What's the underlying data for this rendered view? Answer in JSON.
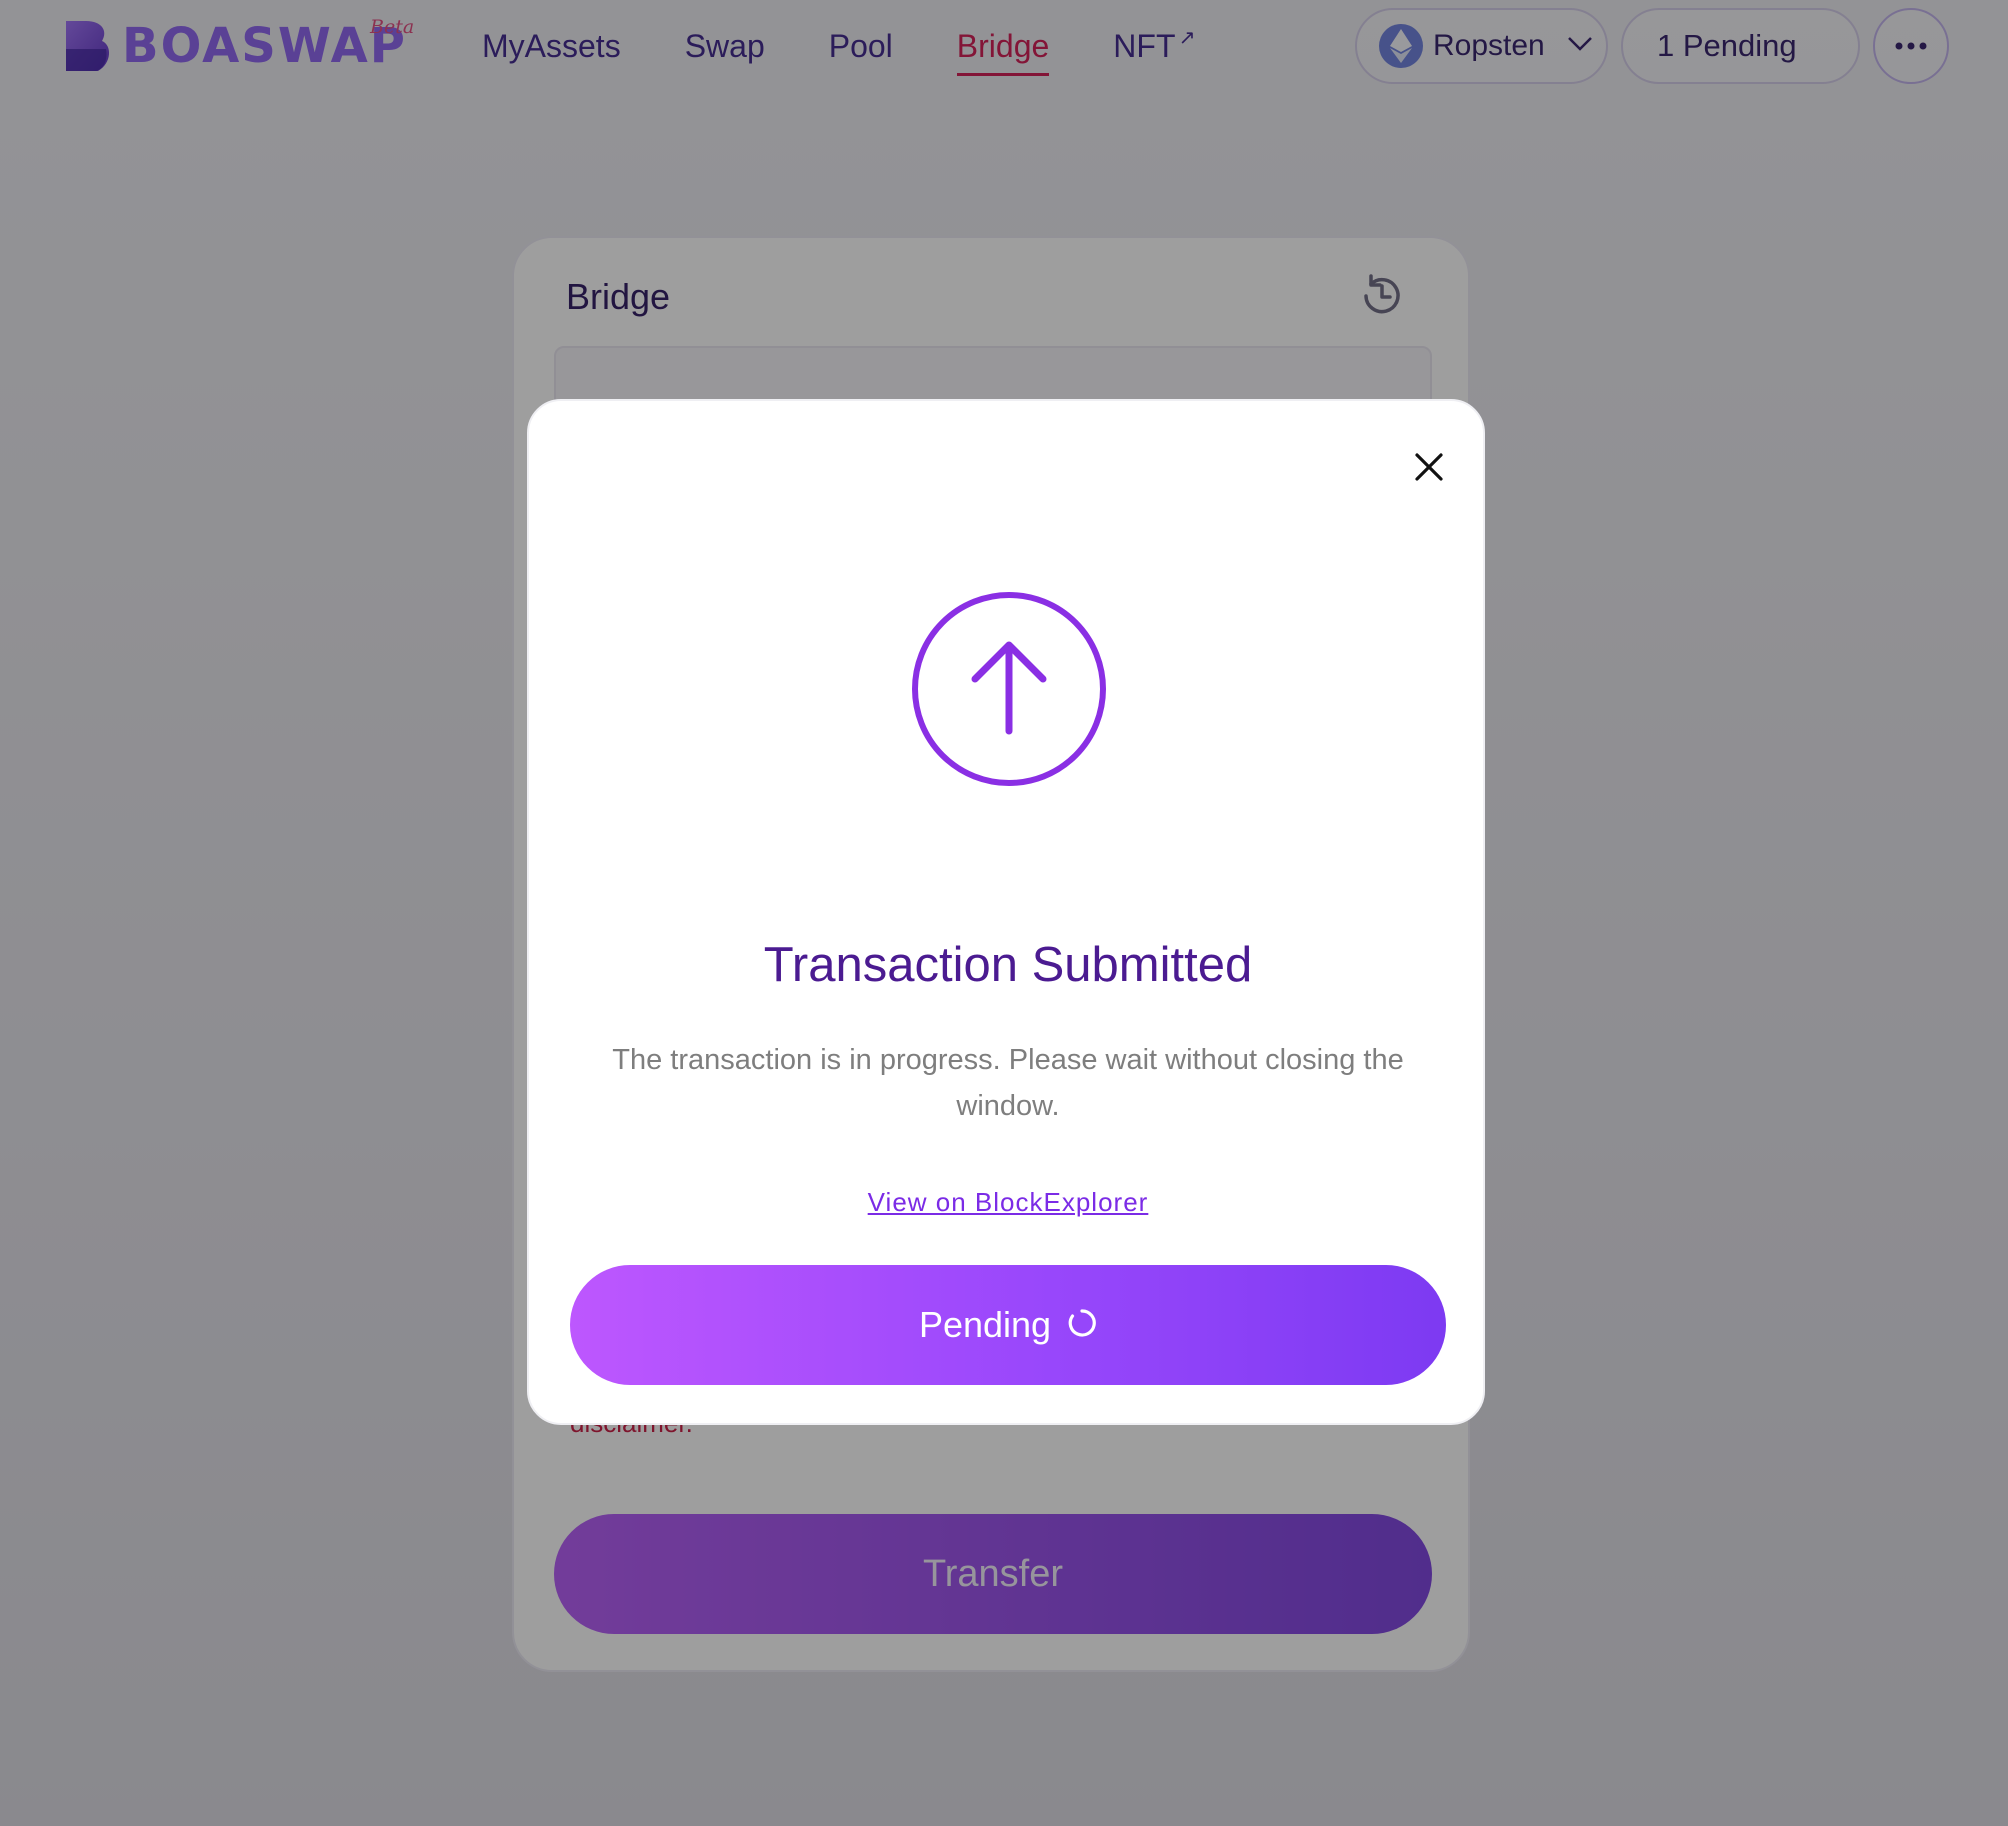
{
  "header": {
    "logo_text": "BOASWAP",
    "logo_badge": "Beta",
    "nav": [
      {
        "label": "MyAssets",
        "active": false
      },
      {
        "label": "Swap",
        "active": false
      },
      {
        "label": "Pool",
        "active": false
      },
      {
        "label": "Bridge",
        "active": true
      },
      {
        "label": "NFT",
        "active": false,
        "external": true
      }
    ],
    "nft_external_icon": "arrow-up-right-icon",
    "network": {
      "label": "Ropsten",
      "icon": "ethereum-icon"
    },
    "pending_label": "1 Pending",
    "more_icon": "more-dots-icon"
  },
  "bridge": {
    "title": "Bridge",
    "history_icon": "history-icon",
    "disclaimer_partial": "disclaimer.",
    "transfer_label": "Transfer"
  },
  "modal": {
    "status_icon": "arrow-up-circle-icon",
    "close_icon": "close-icon",
    "title": "Transaction Submitted",
    "description": "The transaction is in progress. Please wait without closing the window.",
    "explorer_link": "View on BlockExplorer",
    "pending_button": "Pending",
    "spinner_icon": "spinner-icon"
  },
  "colors": {
    "brand_purple": "#8a5ff0",
    "nav_text": "#3a1f8a",
    "nav_active": "#d1134f",
    "modal_title": "#4b1b91",
    "button_gradient_start": "#bd57fe",
    "button_gradient_end": "#7d3af2",
    "link": "#7b2be6"
  }
}
